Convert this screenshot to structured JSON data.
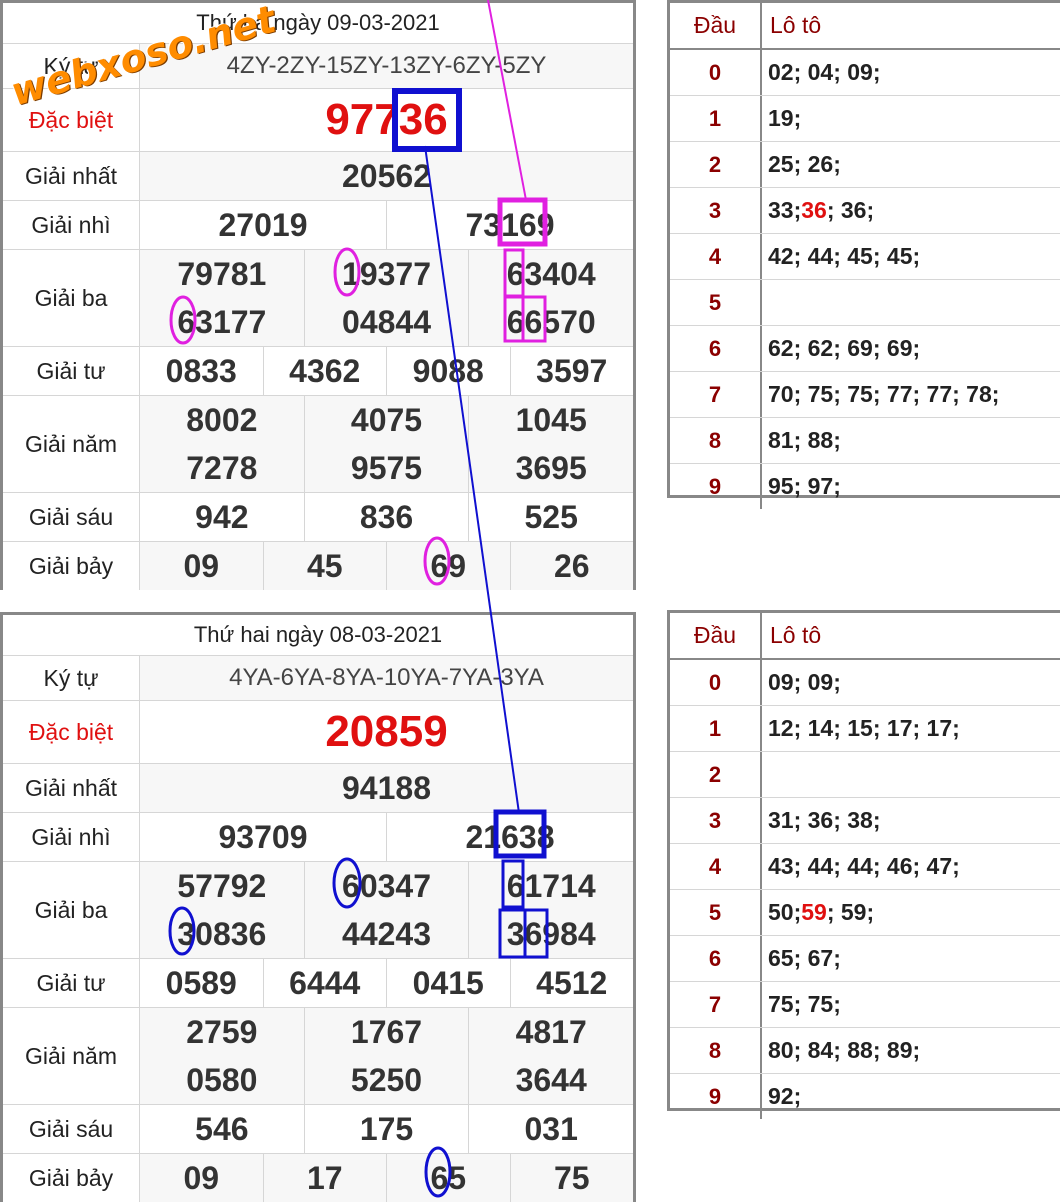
{
  "watermark": "webxoso.net",
  "draws": [
    {
      "date": "Thứ ba ngày 09-03-2021",
      "rows": [
        {
          "label": "Ký tự",
          "lines": [
            [
              "4ZY-2ZY-15ZY-13ZY-6ZY-5ZY"
            ]
          ],
          "kind": "kt"
        },
        {
          "label": "Đặc biệt",
          "lines": [
            [
              "97736"
            ]
          ],
          "kind": "db"
        },
        {
          "label": "Giải nhất",
          "lines": [
            [
              "20562"
            ]
          ]
        },
        {
          "label": "Giải nhì",
          "lines": [
            [
              "27019",
              "73169"
            ]
          ]
        },
        {
          "label": "Giải ba",
          "lines": [
            [
              "79781",
              "19377",
              "63404"
            ],
            [
              "63177",
              "04844",
              "66570"
            ]
          ]
        },
        {
          "label": "Giải tư",
          "lines": [
            [
              "0833",
              "4362",
              "9088",
              "3597"
            ]
          ]
        },
        {
          "label": "Giải năm",
          "lines": [
            [
              "8002",
              "4075",
              "1045"
            ],
            [
              "7278",
              "9575",
              "3695"
            ]
          ]
        },
        {
          "label": "Giải sáu",
          "lines": [
            [
              "942",
              "836",
              "525"
            ]
          ]
        },
        {
          "label": "Giải bảy",
          "lines": [
            [
              "09",
              "45",
              "69",
              "26"
            ]
          ]
        }
      ]
    },
    {
      "date": "Thứ hai ngày 08-03-2021",
      "rows": [
        {
          "label": "Ký tự",
          "lines": [
            [
              "4YA-6YA-8YA-10YA-7YA-3YA"
            ]
          ],
          "kind": "kt"
        },
        {
          "label": "Đặc biệt",
          "lines": [
            [
              "20859"
            ]
          ],
          "kind": "db"
        },
        {
          "label": "Giải nhất",
          "lines": [
            [
              "94188"
            ]
          ]
        },
        {
          "label": "Giải nhì",
          "lines": [
            [
              "93709",
              "21638"
            ]
          ]
        },
        {
          "label": "Giải ba",
          "lines": [
            [
              "57792",
              "60347",
              "61714"
            ],
            [
              "30836",
              "44243",
              "36984"
            ]
          ]
        },
        {
          "label": "Giải tư",
          "lines": [
            [
              "0589",
              "6444",
              "0415",
              "4512"
            ]
          ]
        },
        {
          "label": "Giải năm",
          "lines": [
            [
              "2759",
              "1767",
              "4817"
            ],
            [
              "0580",
              "5250",
              "3644"
            ]
          ]
        },
        {
          "label": "Giải sáu",
          "lines": [
            [
              "546",
              "175",
              "031"
            ]
          ]
        },
        {
          "label": "Giải bảy",
          "lines": [
            [
              "09",
              "17",
              "65",
              "75"
            ]
          ]
        }
      ]
    }
  ],
  "loto_tables": [
    {
      "header": {
        "dau": "Đầu",
        "loto": "Lô tô"
      },
      "rows": [
        {
          "dau": "0",
          "parts": [
            {
              "t": "02; 04; 09;"
            }
          ]
        },
        {
          "dau": "1",
          "parts": [
            {
              "t": "19;"
            }
          ]
        },
        {
          "dau": "2",
          "parts": [
            {
              "t": "25; 26;"
            }
          ]
        },
        {
          "dau": "3",
          "parts": [
            {
              "t": "33; "
            },
            {
              "t": "36",
              "hl": true
            },
            {
              "t": "; 36;"
            }
          ]
        },
        {
          "dau": "4",
          "parts": [
            {
              "t": "42; 44; 45; 45;"
            }
          ]
        },
        {
          "dau": "5",
          "parts": []
        },
        {
          "dau": "6",
          "parts": [
            {
              "t": "62; 62; 69; 69;"
            }
          ]
        },
        {
          "dau": "7",
          "parts": [
            {
              "t": "70; 75; 75; 77; 77; 78;"
            }
          ]
        },
        {
          "dau": "8",
          "parts": [
            {
              "t": "81; 88;"
            }
          ]
        },
        {
          "dau": "9",
          "parts": [
            {
              "t": "95; 97;"
            }
          ]
        }
      ]
    },
    {
      "header": {
        "dau": "Đầu",
        "loto": "Lô tô"
      },
      "rows": [
        {
          "dau": "0",
          "parts": [
            {
              "t": "09; 09;"
            }
          ]
        },
        {
          "dau": "1",
          "parts": [
            {
              "t": "12; 14; 15; 17; 17;"
            }
          ]
        },
        {
          "dau": "2",
          "parts": []
        },
        {
          "dau": "3",
          "parts": [
            {
              "t": "31; 36; 38;"
            }
          ]
        },
        {
          "dau": "4",
          "parts": [
            {
              "t": "43; 44; 44; 46; 47;"
            }
          ]
        },
        {
          "dau": "5",
          "parts": [
            {
              "t": "50; "
            },
            {
              "t": "59",
              "hl": true
            },
            {
              "t": "; 59;"
            }
          ]
        },
        {
          "dau": "6",
          "parts": [
            {
              "t": "65; 67;"
            }
          ]
        },
        {
          "dau": "7",
          "parts": [
            {
              "t": "75; 75;"
            }
          ]
        },
        {
          "dau": "8",
          "parts": [
            {
              "t": "80; 84; 88; 89;"
            }
          ]
        },
        {
          "dau": "9",
          "parts": [
            {
              "t": "92;"
            }
          ]
        }
      ]
    }
  ],
  "colors": {
    "special": "#e01010",
    "magenta": "#e020e0",
    "blue": "#1010d0",
    "watermark": "#ff8c00"
  }
}
